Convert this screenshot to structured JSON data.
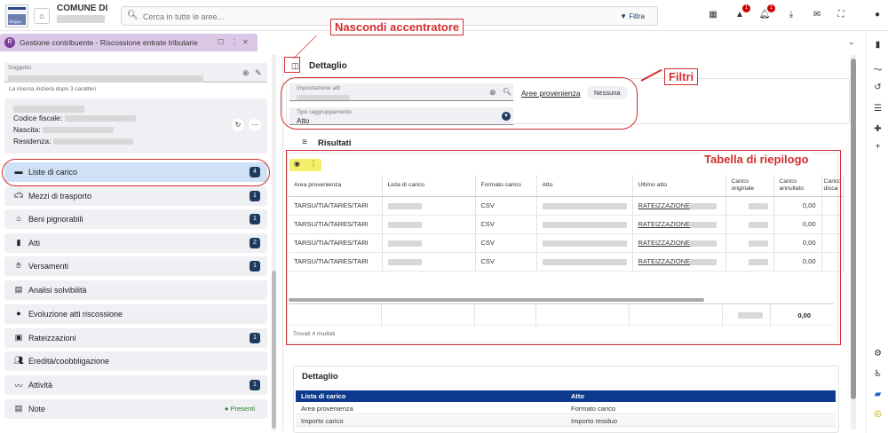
{
  "topbar": {
    "comune_label": "COMUNE DI",
    "search_placeholder": "Cerca in tutte le aree...",
    "filtra_label": "Filtra",
    "notification_badges": [
      "1",
      "1"
    ]
  },
  "tab": {
    "label": "Gestione contribuente - Riscossione entrate tributarie"
  },
  "left": {
    "soggetto_label": "Soggetto",
    "search_hint": "La ricerca inizierà dopo 3 caratteri",
    "codice_fiscale_label": "Codice fiscale:",
    "nascita_label": "Nascita:",
    "residenza_label": "Residenza:",
    "menu": [
      {
        "label": "Liste di carico",
        "count": "4",
        "icon": "list-icon"
      },
      {
        "label": "Mezzi di trasporto",
        "count": "1",
        "icon": "car-icon"
      },
      {
        "label": "Beni pignorabili",
        "count": "1",
        "icon": "house-icon"
      },
      {
        "label": "Atti",
        "count": "2",
        "icon": "document-icon"
      },
      {
        "label": "Versamenti",
        "count": "1",
        "icon": "hand-coin-icon"
      },
      {
        "label": "Analisi solvibilità",
        "count": "",
        "icon": "chart-icon"
      },
      {
        "label": "Evoluzione atti riscossione",
        "count": "",
        "icon": "evolution-icon"
      },
      {
        "label": "Rateizzazioni",
        "count": "1",
        "icon": "installments-icon"
      },
      {
        "label": "Eredità/coobbligazione",
        "count": "",
        "icon": "people-icon"
      },
      {
        "label": "Attività",
        "count": "1",
        "icon": "activity-icon"
      },
      {
        "label": "Note",
        "count": "",
        "icon": "note-icon",
        "status": "Presenti"
      }
    ]
  },
  "main": {
    "detail_title": "Dettaglio",
    "filters": {
      "impostazione_label": "Impostazione atti",
      "tipo_label": "Tipo raggruppamento",
      "tipo_value": "Atto",
      "aree_link": "Aree provenienza",
      "aree_chip": "Nessuna"
    },
    "results_title": "Risultati",
    "table": {
      "headers": [
        "Area provenienza",
        "Lista di carico",
        "Formato carico",
        "Atto",
        "Ultimo atto",
        "Carico originale",
        "Carico annullato",
        "Carico discaricato"
      ],
      "header_display": [
        "Area provenienza",
        "Lista di carico",
        "Formato carico",
        "Atto",
        "Ultimo atto",
        "Carico originale",
        "Carico annullato",
        "Carico disca"
      ],
      "rows": [
        {
          "area": "TARSU/TIA/TARES/TARI",
          "formato": "CSV",
          "ultimo": "RATEIZZAZIONE",
          "annullato": "0,00"
        },
        {
          "area": "TARSU/TIA/TARES/TARI",
          "formato": "CSV",
          "ultimo": "RATEIZZAZIONE",
          "annullato": "0,00"
        },
        {
          "area": "TARSU/TIA/TARES/TARI",
          "formato": "CSV",
          "ultimo": "RATEIZZAZIONE",
          "annullato": "0,00"
        },
        {
          "area": "TARSU/TIA/TARES/TARI",
          "formato": "CSV",
          "ultimo": "RATEIZZAZIONE",
          "annullato": "0,00"
        }
      ],
      "total_annullato": "0,00",
      "found_text": "Trovati 4 risultati"
    },
    "detail2": {
      "title": "Dettaglio",
      "header_left": "Lista di carico",
      "header_right": "Atto",
      "rows": [
        {
          "left": "Area provenienza",
          "right": "Formato carico"
        },
        {
          "left": "Importo carico",
          "right": "Importo residuo"
        }
      ]
    }
  },
  "annotations": {
    "nascondi": "Nascondi accentratore",
    "filtri": "Filtri",
    "tabella": "Tabella di riepilogo"
  },
  "colors": {
    "accent": "#0d3a8c",
    "annotation": "#d32f2f",
    "tab": "#dcc8e6",
    "menu_active": "#cfe2f5",
    "count_badge": "#1e3a5f"
  }
}
